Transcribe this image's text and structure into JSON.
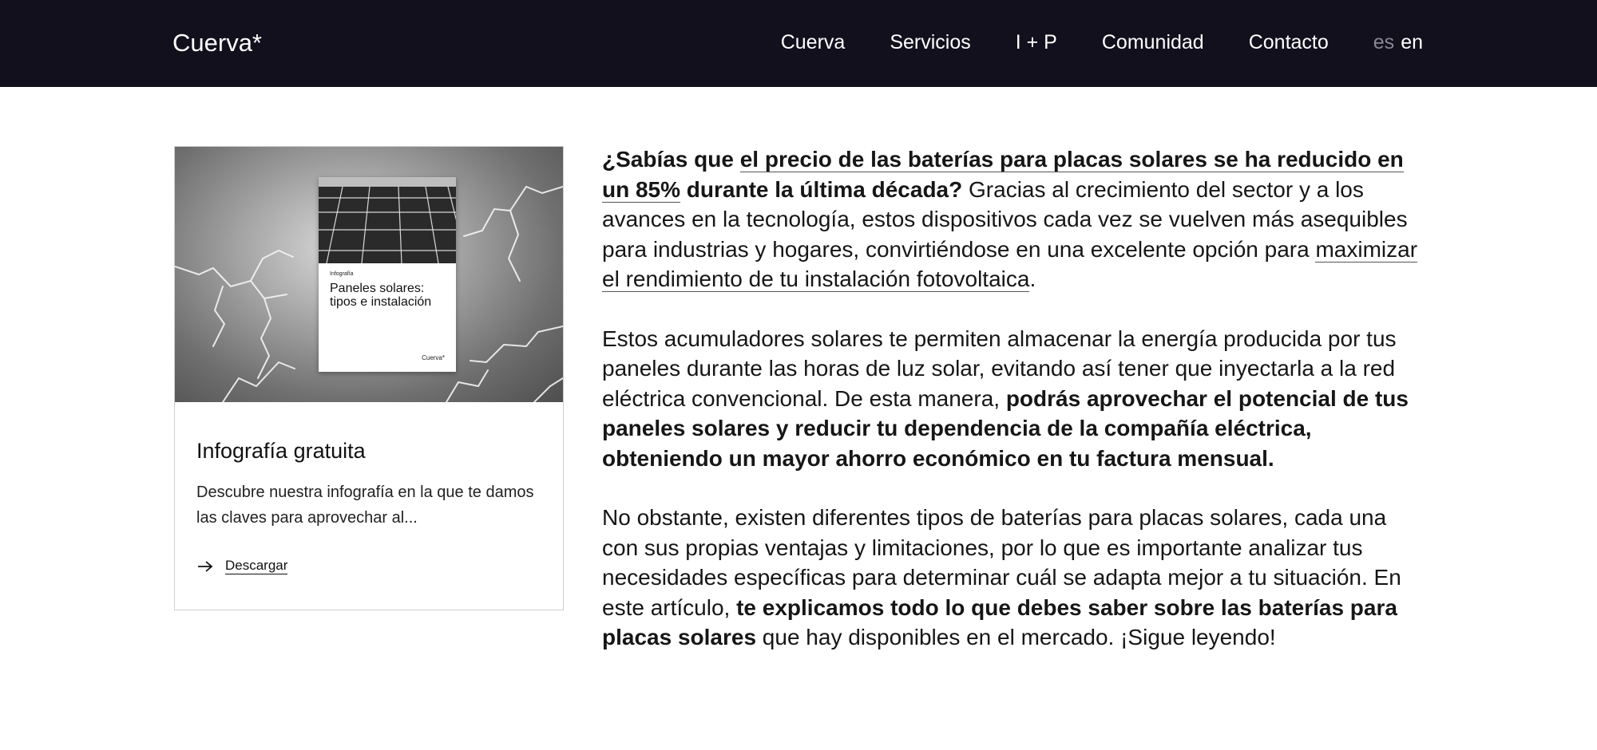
{
  "header": {
    "logo": "Cuerva*",
    "nav": [
      "Cuerva",
      "Servicios",
      "I + P",
      "Comunidad",
      "Contacto"
    ],
    "lang_inactive": "es",
    "lang_active": "en"
  },
  "card": {
    "poster_tag": "Infografía",
    "poster_title": "Paneles solares: tipos e instalación",
    "poster_logo": "Cuerva*",
    "title": "Infografía gratuita",
    "description": "Descubre nuestra infografía en la que te damos las claves para aprovechar al...",
    "link_label": "Descargar",
    "link_icon": "arrow-right-icon"
  },
  "article": {
    "p1": {
      "a": "¿Sabías que ",
      "b": "el precio de las baterías para placas solares se ha reducido en un 85%",
      "c": " durante la última década?",
      "d": " Gracias al crecimiento del sector y a los avances en la tecnología, estos dispositivos cada vez se vuelven más asequibles para industrias y hogares, convirtiéndose en una excelente opción para ",
      "e": "maximizar el rendimiento de tu instalación fotovoltaica",
      "f": "."
    },
    "p2": {
      "a": "Estos acumuladores solares te permiten almacenar la energía producida por tus paneles durante las horas de luz solar, evitando así tener que inyectarla a la red eléctrica convencional. De esta manera, ",
      "b": "podrás aprovechar el potencial de tus paneles solares y reducir tu dependencia de la compañía eléctrica, obteniendo un mayor ahorro económico en tu factura mensual."
    },
    "p3": {
      "a": "No obstante, existen diferentes tipos de baterías para placas solares, cada una con sus propias ventajas y limitaciones, por lo que es importante analizar tus necesidades específicas para determinar cuál se adapta mejor a tu situación. En este artículo, ",
      "b": "te explicamos todo lo que debes saber sobre las baterías para placas solares",
      "c": " que hay disponibles en el mercado. ¡Sigue leyendo!"
    }
  },
  "colors": {
    "header_bg": "#12101c",
    "text": "#161616",
    "muted_lang": "#8a8794"
  }
}
